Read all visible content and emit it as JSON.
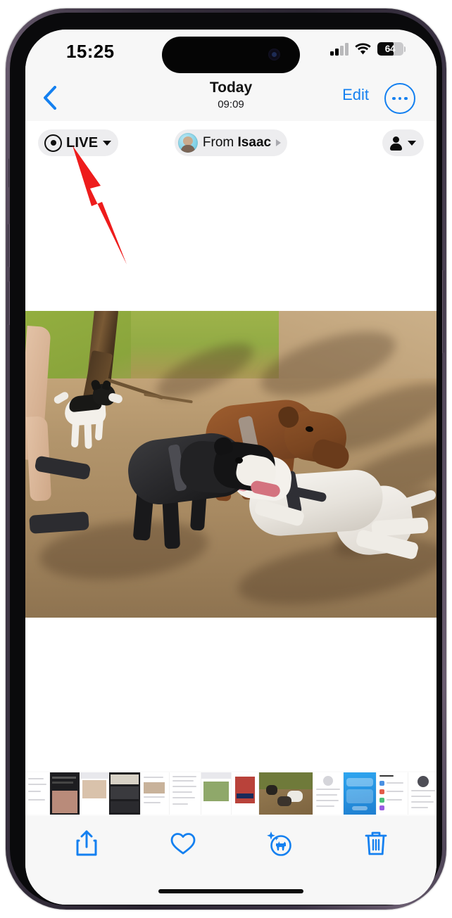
{
  "status_bar": {
    "time": "15:25",
    "signal_icon": "cellular-signal-icon",
    "signal_bars_filled": 2,
    "signal_bars_total": 4,
    "wifi_icon": "wifi-icon",
    "battery_percent": "64",
    "battery_level": 64
  },
  "nav_bar": {
    "back_icon": "chevron-left-icon",
    "title": "Today",
    "subtitle": "09:09",
    "edit_label": "Edit",
    "more_icon": "ellipsis-circle-icon"
  },
  "chips": {
    "live": {
      "icon": "live-photo-icon",
      "label": "LIVE",
      "chevron_icon": "chevron-down-icon"
    },
    "from": {
      "avatar": "contact-avatar",
      "prefix": "From",
      "name": "Isaac",
      "chevron_icon": "chevron-right-icon"
    },
    "people": {
      "icon": "person-icon",
      "chevron_icon": "chevron-down-icon"
    }
  },
  "photo": {
    "description": "Four dogs playing in a dirt dog park with grass and a tree trunk; a person's legs in sandals at left",
    "colors": {
      "dirt": "#b2956c",
      "grass": "#9eb34a",
      "shadow": "#3c2816"
    }
  },
  "thumbnails": [
    {
      "name": "thumb-document-1",
      "kind": "doc"
    },
    {
      "name": "thumb-screenshot-dark",
      "kind": "dark"
    },
    {
      "name": "thumb-social-post-1",
      "kind": "social"
    },
    {
      "name": "thumb-screenshot-dark-2",
      "kind": "dark"
    },
    {
      "name": "thumb-document-2",
      "kind": "doc"
    },
    {
      "name": "thumb-social-post-2",
      "kind": "social"
    },
    {
      "name": "thumb-photo-dogs",
      "kind": "photo"
    },
    {
      "name": "thumb-document-3",
      "kind": "doc"
    },
    {
      "name": "thumb-home-screen",
      "kind": "blue"
    },
    {
      "name": "thumb-settings",
      "kind": "doc"
    },
    {
      "name": "thumb-contact-card",
      "kind": "doc"
    },
    {
      "name": "thumb-email-list",
      "kind": "doc"
    },
    {
      "name": "thumb-receipt-1",
      "kind": "doc"
    },
    {
      "name": "thumb-receipt-2",
      "kind": "doc"
    },
    {
      "name": "thumb-receipt-3",
      "kind": "doc"
    }
  ],
  "toolbar": {
    "share_icon": "share-icon",
    "favorite_icon": "heart-icon",
    "visual_lookup_icon": "visual-lookup-dog-icon",
    "delete_icon": "trash-icon",
    "accent_color": "#1480f0"
  },
  "annotation": {
    "arrow_icon": "red-arrow-annotation",
    "color": "#ee1c1c",
    "points_to": "LIVE"
  }
}
